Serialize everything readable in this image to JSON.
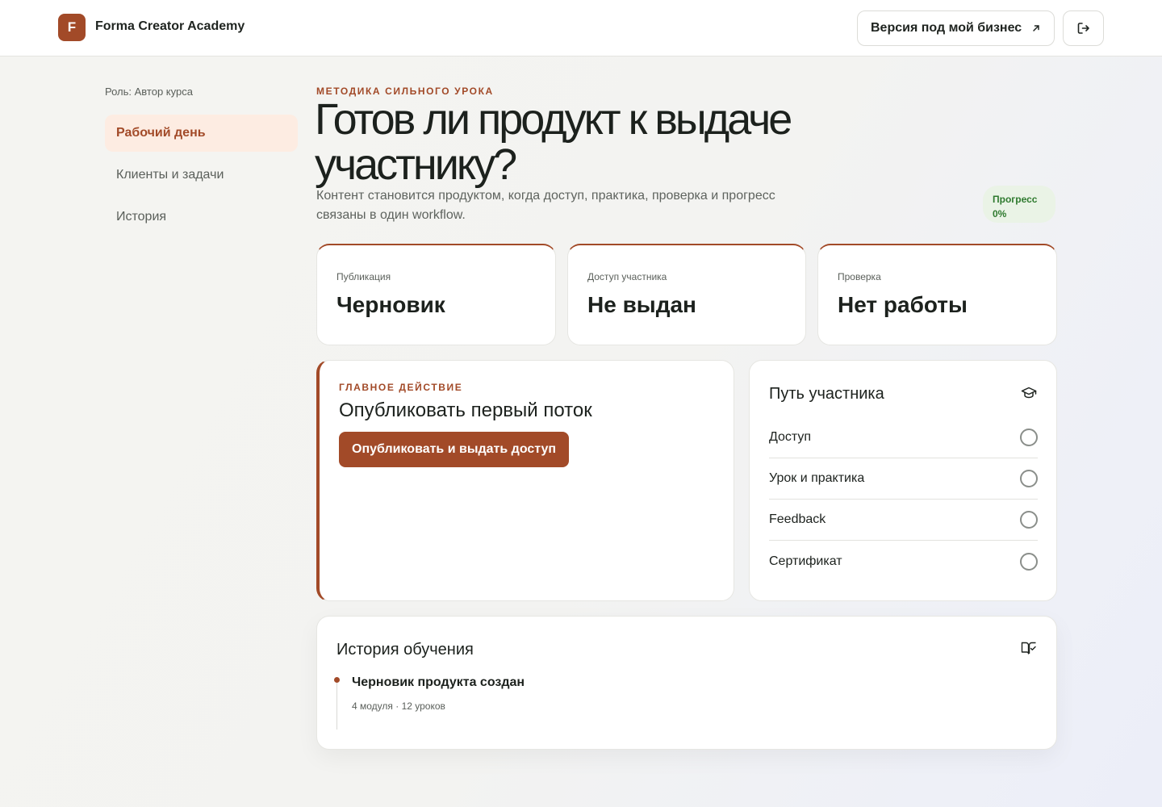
{
  "header": {
    "logo_letter": "F",
    "brand": "Forma Creator Academy",
    "business_button": "Версия под мой бизнес",
    "business_icon": "arrow-up-right-icon",
    "logout_icon": "logout-icon"
  },
  "sidebar": {
    "role": "Роль: Автор курса",
    "items": [
      {
        "label": "Рабочий день",
        "active": true
      },
      {
        "label": "Клиенты и задачи",
        "active": false
      },
      {
        "label": "История",
        "active": false
      }
    ]
  },
  "hero": {
    "eyebrow": "МЕТОДИКА СИЛЬНОГО УРОКА",
    "title": "Готов ли продукт к выдаче участнику?",
    "subtitle": "Контент становится продуктом, когда доступ, практика, проверка и прогресс связаны в один workflow.",
    "progress_label": "Прогресс",
    "progress_value": "0%"
  },
  "stats": [
    {
      "label": "Публикация",
      "value": "Черновик"
    },
    {
      "label": "Доступ участника",
      "value": "Не выдан"
    },
    {
      "label": "Проверка",
      "value": "Нет работы"
    }
  ],
  "action": {
    "eyebrow": "ГЛАВНОЕ ДЕЙСТВИЕ",
    "title": "Опубликовать первый поток",
    "button": "Опубликовать и выдать доступ"
  },
  "path": {
    "title": "Путь участника",
    "icon": "graduation-cap-icon",
    "steps": [
      {
        "label": "Доступ",
        "done": false
      },
      {
        "label": "Урок и практика",
        "done": false
      },
      {
        "label": "Feedback",
        "done": false
      },
      {
        "label": "Сертификат",
        "done": false
      }
    ]
  },
  "history": {
    "title": "История обучения",
    "icon": "book-check-icon",
    "events": [
      {
        "title": "Черновик продукта создан",
        "meta": "4 модуля · 12 уроков"
      }
    ]
  },
  "colors": {
    "accent": "#a24a28",
    "active_nav_bg": "#fdece2",
    "progress_chip_bg": "#eaf3e6",
    "progress_text": "#2f7a2f"
  }
}
